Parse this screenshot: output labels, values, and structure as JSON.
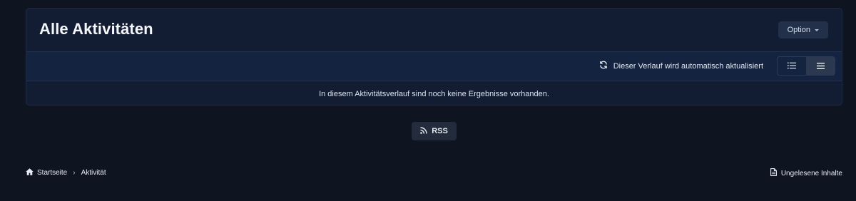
{
  "header": {
    "title": "Alle Aktivitäten",
    "option_label": "Option"
  },
  "toolbar": {
    "autorefresh_text": "Dieser Verlauf wird automatisch aktualisiert",
    "view_modes": [
      "expanded-list",
      "condensed-list"
    ],
    "active_view": "condensed-list"
  },
  "stream": {
    "empty_message": "In diesem Aktivitätsverlauf sind noch keine Ergebnisse vorhanden."
  },
  "rss": {
    "label": "RSS"
  },
  "breadcrumb": {
    "items": [
      {
        "label": "Startseite",
        "icon": "home-icon"
      },
      {
        "label": "Aktivität"
      }
    ]
  },
  "footer": {
    "unread_label": "Ungelesene Inhalte",
    "unread_icon": "document-icon"
  },
  "colors": {
    "page_bg": "#0e1420",
    "panel_bg": "#121d33",
    "toolbar_bg": "#142340",
    "button_bg": "#23304a"
  }
}
